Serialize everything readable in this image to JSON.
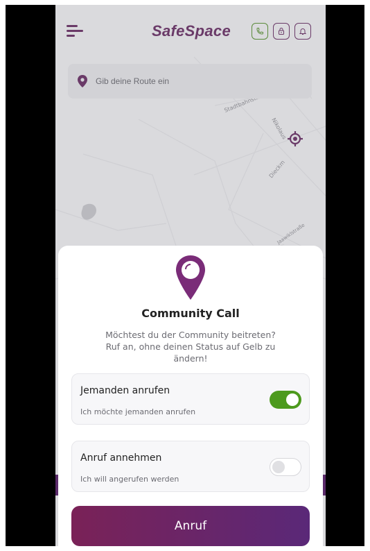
{
  "header": {
    "app_title": "SafeSpace",
    "icons": [
      "menu-icon",
      "phone-icon",
      "lock-icon",
      "bell-icon"
    ]
  },
  "search": {
    "placeholder": "Gib deine Route ein"
  },
  "map": {
    "street_labels": [
      "Stadtbahnstr.",
      "Nikolaus",
      "Dieckm",
      "Jaawiklstraße"
    ]
  },
  "modal": {
    "title": "Community Call",
    "description": "Möchtest du der Community beitreten? Ruf an, ohne deinen Status auf Gelb zu ändern!",
    "options": [
      {
        "title": "Jemanden anrufen",
        "subtitle": "Ich möchte jemanden anrufen",
        "enabled": true
      },
      {
        "title": "Anruf annehmen",
        "subtitle": "Ich will angerufen werden",
        "enabled": false
      }
    ],
    "button_label": "Anruf"
  },
  "colors": {
    "brand_purple": "#6a3a68",
    "toggle_on": "#4d9a1e",
    "button_gradient_start": "#7a2257",
    "button_gradient_end": "#5a2878"
  }
}
